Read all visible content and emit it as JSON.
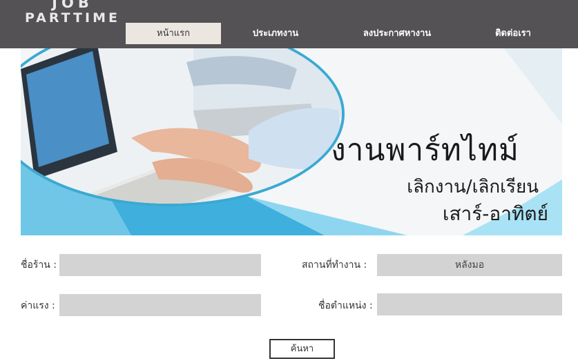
{
  "logo": {
    "line1": "JOB",
    "line2": "PARTTIME"
  },
  "nav": [
    {
      "label": "หน้าแรก"
    },
    {
      "label": "ประเภทงาน"
    },
    {
      "label": "ลงประกาศหางาน"
    },
    {
      "label": "ติดต่อเรา"
    }
  ],
  "banner": {
    "title": "งานพาร์ทไทม์",
    "line2": "เลิกงาน/เลิกเรียน",
    "line3": "เสาร์-อาทิตย์"
  },
  "form": {
    "shop_label": "ชื่อร้าน :",
    "shop_value": "",
    "location_label": "สถานที่ทำงาน :",
    "location_value": "หลังมอ",
    "wage_label": "ค่าแรง :",
    "wage_value": "",
    "position_label": "ชื่อตำแหน่ง :",
    "position_value": "",
    "search_button": "ค้นหา"
  },
  "colors": {
    "header_bg": "#545254",
    "nav_active_bg": "#ece6e1",
    "field_bg": "#d3d3d3",
    "accent_blue": "#3aa9d1"
  }
}
